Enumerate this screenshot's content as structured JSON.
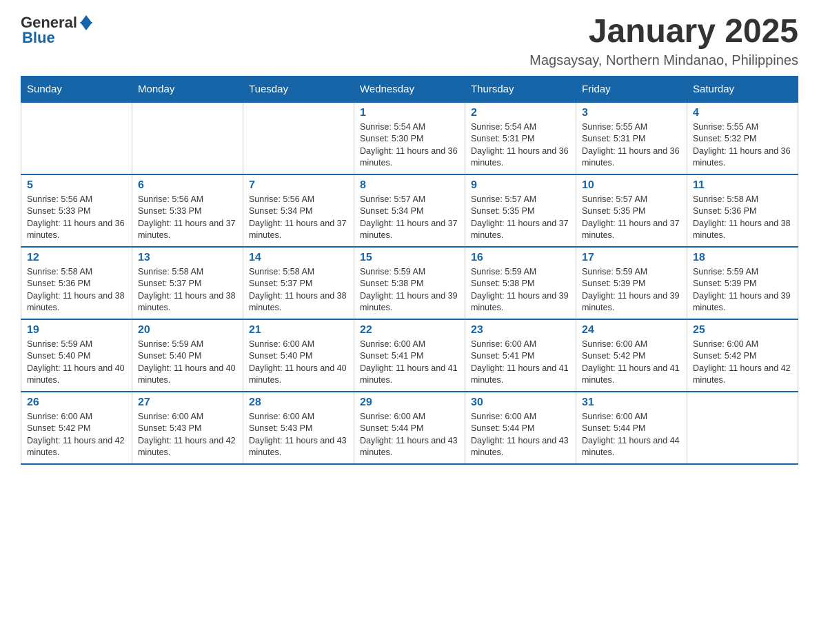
{
  "logo": {
    "general": "General",
    "blue": "Blue"
  },
  "title": "January 2025",
  "subtitle": "Magsaysay, Northern Mindanao, Philippines",
  "days_of_week": [
    "Sunday",
    "Monday",
    "Tuesday",
    "Wednesday",
    "Thursday",
    "Friday",
    "Saturday"
  ],
  "weeks": [
    [
      {
        "day": "",
        "info": ""
      },
      {
        "day": "",
        "info": ""
      },
      {
        "day": "",
        "info": ""
      },
      {
        "day": "1",
        "info": "Sunrise: 5:54 AM\nSunset: 5:30 PM\nDaylight: 11 hours and 36 minutes."
      },
      {
        "day": "2",
        "info": "Sunrise: 5:54 AM\nSunset: 5:31 PM\nDaylight: 11 hours and 36 minutes."
      },
      {
        "day": "3",
        "info": "Sunrise: 5:55 AM\nSunset: 5:31 PM\nDaylight: 11 hours and 36 minutes."
      },
      {
        "day": "4",
        "info": "Sunrise: 5:55 AM\nSunset: 5:32 PM\nDaylight: 11 hours and 36 minutes."
      }
    ],
    [
      {
        "day": "5",
        "info": "Sunrise: 5:56 AM\nSunset: 5:33 PM\nDaylight: 11 hours and 36 minutes."
      },
      {
        "day": "6",
        "info": "Sunrise: 5:56 AM\nSunset: 5:33 PM\nDaylight: 11 hours and 37 minutes."
      },
      {
        "day": "7",
        "info": "Sunrise: 5:56 AM\nSunset: 5:34 PM\nDaylight: 11 hours and 37 minutes."
      },
      {
        "day": "8",
        "info": "Sunrise: 5:57 AM\nSunset: 5:34 PM\nDaylight: 11 hours and 37 minutes."
      },
      {
        "day": "9",
        "info": "Sunrise: 5:57 AM\nSunset: 5:35 PM\nDaylight: 11 hours and 37 minutes."
      },
      {
        "day": "10",
        "info": "Sunrise: 5:57 AM\nSunset: 5:35 PM\nDaylight: 11 hours and 37 minutes."
      },
      {
        "day": "11",
        "info": "Sunrise: 5:58 AM\nSunset: 5:36 PM\nDaylight: 11 hours and 38 minutes."
      }
    ],
    [
      {
        "day": "12",
        "info": "Sunrise: 5:58 AM\nSunset: 5:36 PM\nDaylight: 11 hours and 38 minutes."
      },
      {
        "day": "13",
        "info": "Sunrise: 5:58 AM\nSunset: 5:37 PM\nDaylight: 11 hours and 38 minutes."
      },
      {
        "day": "14",
        "info": "Sunrise: 5:58 AM\nSunset: 5:37 PM\nDaylight: 11 hours and 38 minutes."
      },
      {
        "day": "15",
        "info": "Sunrise: 5:59 AM\nSunset: 5:38 PM\nDaylight: 11 hours and 39 minutes."
      },
      {
        "day": "16",
        "info": "Sunrise: 5:59 AM\nSunset: 5:38 PM\nDaylight: 11 hours and 39 minutes."
      },
      {
        "day": "17",
        "info": "Sunrise: 5:59 AM\nSunset: 5:39 PM\nDaylight: 11 hours and 39 minutes."
      },
      {
        "day": "18",
        "info": "Sunrise: 5:59 AM\nSunset: 5:39 PM\nDaylight: 11 hours and 39 minutes."
      }
    ],
    [
      {
        "day": "19",
        "info": "Sunrise: 5:59 AM\nSunset: 5:40 PM\nDaylight: 11 hours and 40 minutes."
      },
      {
        "day": "20",
        "info": "Sunrise: 5:59 AM\nSunset: 5:40 PM\nDaylight: 11 hours and 40 minutes."
      },
      {
        "day": "21",
        "info": "Sunrise: 6:00 AM\nSunset: 5:40 PM\nDaylight: 11 hours and 40 minutes."
      },
      {
        "day": "22",
        "info": "Sunrise: 6:00 AM\nSunset: 5:41 PM\nDaylight: 11 hours and 41 minutes."
      },
      {
        "day": "23",
        "info": "Sunrise: 6:00 AM\nSunset: 5:41 PM\nDaylight: 11 hours and 41 minutes."
      },
      {
        "day": "24",
        "info": "Sunrise: 6:00 AM\nSunset: 5:42 PM\nDaylight: 11 hours and 41 minutes."
      },
      {
        "day": "25",
        "info": "Sunrise: 6:00 AM\nSunset: 5:42 PM\nDaylight: 11 hours and 42 minutes."
      }
    ],
    [
      {
        "day": "26",
        "info": "Sunrise: 6:00 AM\nSunset: 5:42 PM\nDaylight: 11 hours and 42 minutes."
      },
      {
        "day": "27",
        "info": "Sunrise: 6:00 AM\nSunset: 5:43 PM\nDaylight: 11 hours and 42 minutes."
      },
      {
        "day": "28",
        "info": "Sunrise: 6:00 AM\nSunset: 5:43 PM\nDaylight: 11 hours and 43 minutes."
      },
      {
        "day": "29",
        "info": "Sunrise: 6:00 AM\nSunset: 5:44 PM\nDaylight: 11 hours and 43 minutes."
      },
      {
        "day": "30",
        "info": "Sunrise: 6:00 AM\nSunset: 5:44 PM\nDaylight: 11 hours and 43 minutes."
      },
      {
        "day": "31",
        "info": "Sunrise: 6:00 AM\nSunset: 5:44 PM\nDaylight: 11 hours and 44 minutes."
      },
      {
        "day": "",
        "info": ""
      }
    ]
  ]
}
